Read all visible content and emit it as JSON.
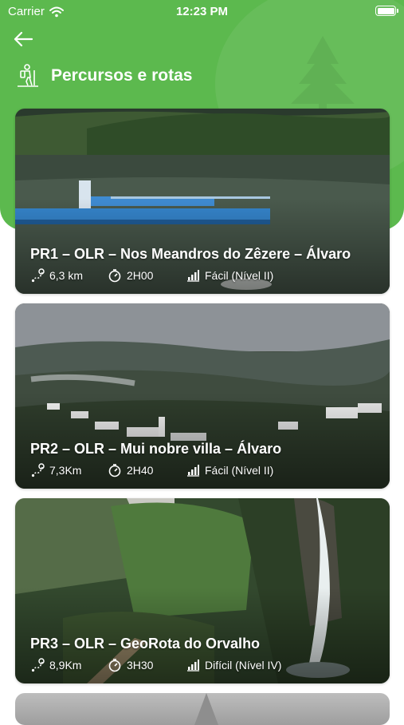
{
  "status_bar": {
    "carrier": "Carrier",
    "time": "12:23 PM"
  },
  "header": {
    "title": "Percursos e rotas",
    "back_icon": "arrow-left-icon",
    "title_icon": "hiker-icon"
  },
  "colors": {
    "primary_green": "#5cb94e"
  },
  "routes": [
    {
      "title": "PR1 – OLR – Nos Meandros do Zêzere – Álvaro",
      "distance": "6,3 km",
      "duration": "2H00",
      "difficulty": "Fácil (Nível II)"
    },
    {
      "title": "PR2 – OLR – Mui nobre villa – Álvaro",
      "distance": "7,3Km",
      "duration": "2H40",
      "difficulty": "Fácil (Nível II)"
    },
    {
      "title": "PR3 – OLR – GeoRota do Orvalho",
      "distance": "8,9Km",
      "duration": "3H30",
      "difficulty": "Difícil (Nível IV)"
    }
  ]
}
